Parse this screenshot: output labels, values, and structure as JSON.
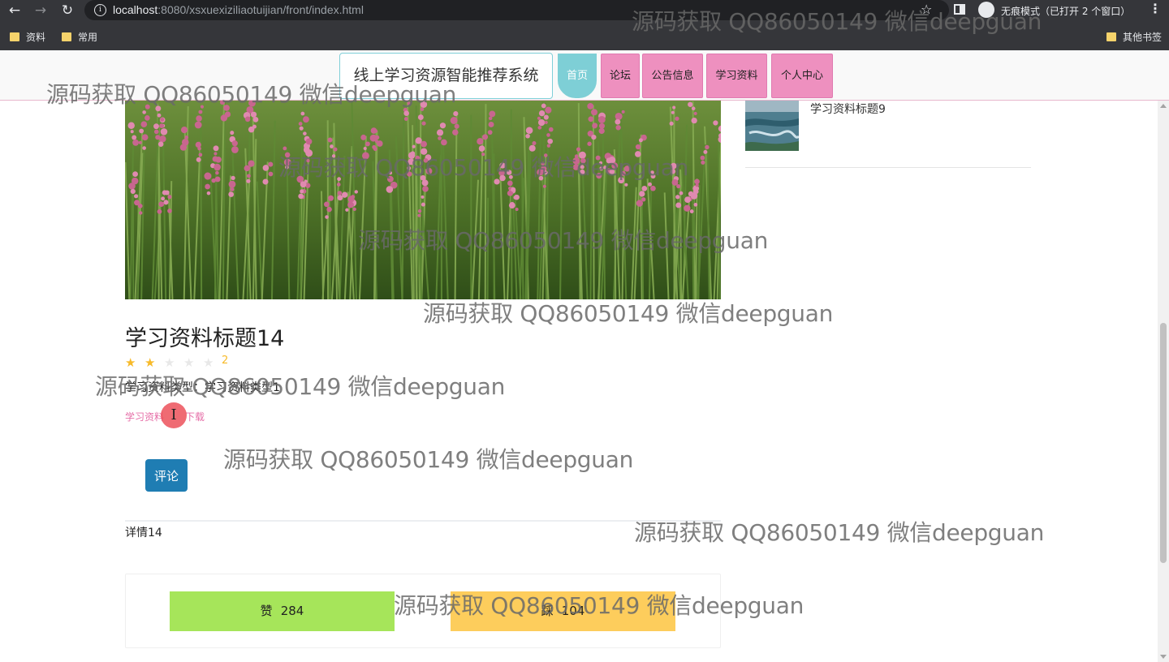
{
  "browser": {
    "url_host": "localhost",
    "url_path": ":8080/xsxuexiziliaotuijian/front/index.html",
    "incognito_label": "无痕模式（已打开 2 个窗口）",
    "bookmarks": [
      "资料",
      "常用"
    ],
    "other_bookmarks": "其他书签",
    "icons": [
      "back-icon",
      "forward-icon",
      "reload-icon",
      "info-icon",
      "star-icon",
      "side-panel-icon",
      "incognito-icon",
      "menu-icon",
      "folder-icon"
    ]
  },
  "nav": {
    "site_title": "线上学习资源智能推荐系统",
    "items": [
      "首页",
      "论坛",
      "公告信息",
      "学习资料",
      "个人中心"
    ],
    "active_index": 0,
    "colors": {
      "active": "#7ecfd6",
      "item": "#ee90bf"
    }
  },
  "sidebar": {
    "items": [
      {
        "title": "学习资料标题9"
      }
    ]
  },
  "detail": {
    "title": "学习资料标题14",
    "rating": {
      "value": 2,
      "max": 5
    },
    "type_label": "学习资料类型：",
    "type_value": "学习资料类型1",
    "download_prefix": "学习资料",
    "download_suffix": "下载",
    "comment_label": "评论",
    "content": "详情14",
    "thumbup_label": "赞",
    "thumbup_count": "284",
    "thumbdown_label": "踩",
    "thumbdown_count": "104",
    "colors": {
      "comment": "#1f7db3",
      "thumbup": "#a6e55a",
      "thumbdown": "#fdcd5c",
      "link": "#e66fa8",
      "star": "#f7ba2a"
    }
  },
  "watermark_text": "源码获取 QQ86050149 微信deepguan"
}
